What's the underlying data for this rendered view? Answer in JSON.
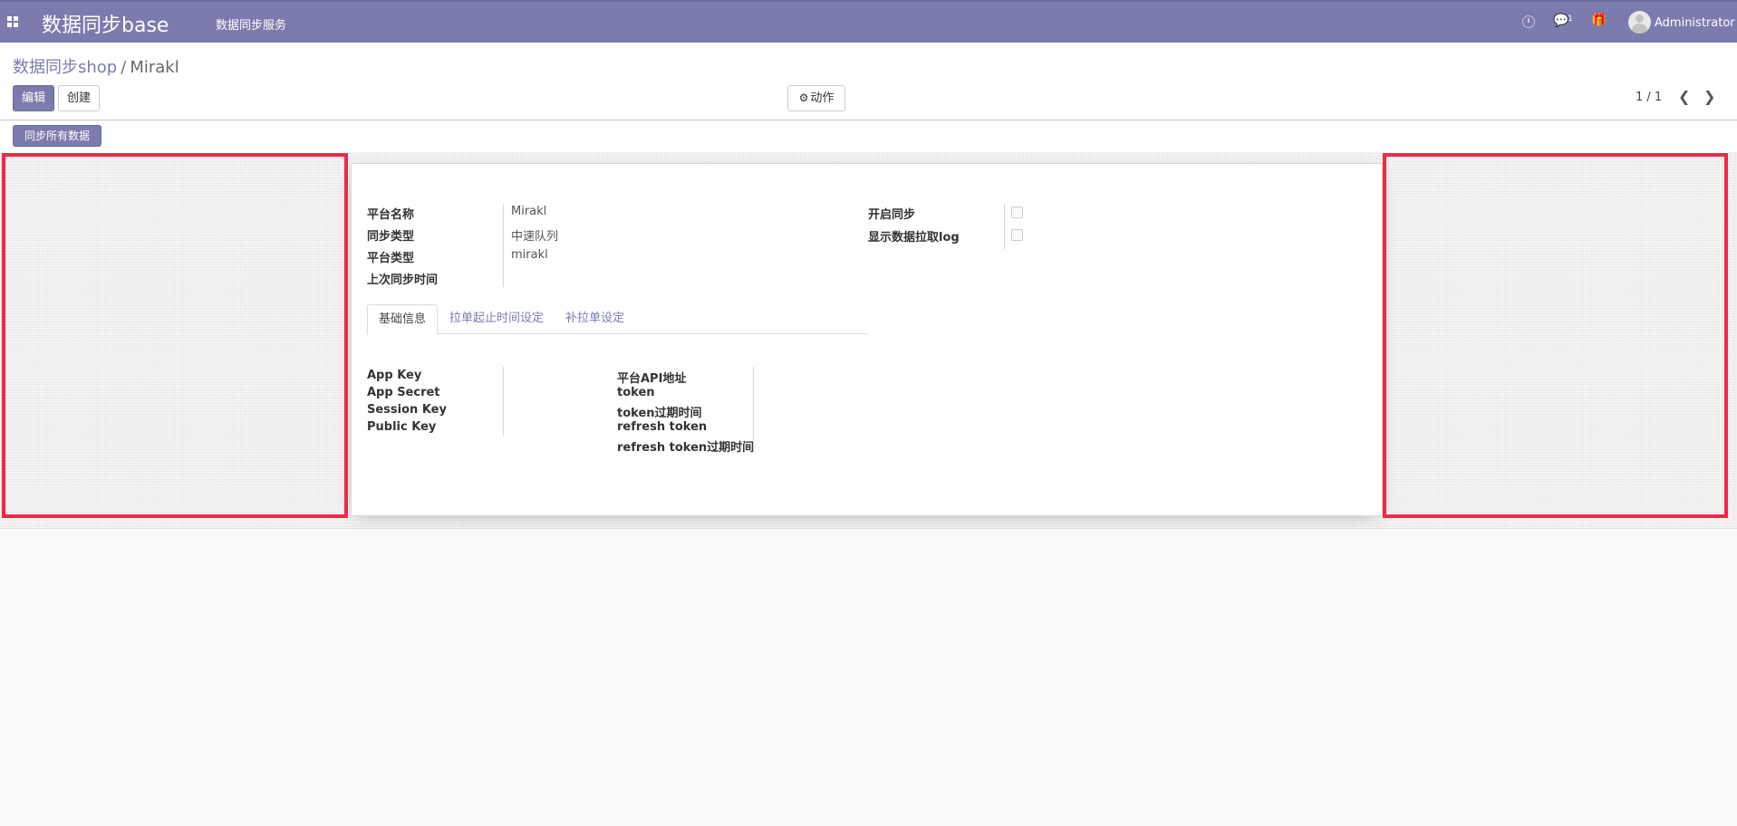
{
  "navbar": {
    "app_title": "数据同步base",
    "menu_items": [
      "数据同步服务"
    ],
    "chat_count": "1",
    "user_name": "Administrator",
    "icons": [
      "apps-grid-icon",
      "clock-icon",
      "chat-icon",
      "gift-icon",
      "avatar"
    ]
  },
  "breadcrumb": {
    "parent": "数据同步shop",
    "separator": "/",
    "current": "Mirakl"
  },
  "toolbar": {
    "edit_label": "编辑",
    "create_label": "创建",
    "action_label": "动作",
    "pager": "1 / 1",
    "prev_icon": "chevron-left-icon",
    "next_icon": "chevron-right-icon"
  },
  "statusbar": {
    "sync_all_label": "同步所有数据"
  },
  "form": {
    "left_fields": [
      {
        "label": "平台名称",
        "value": "Mirakl"
      },
      {
        "label": "同步类型",
        "value": "中速队列"
      },
      {
        "label": "平台类型",
        "value": "mirakl"
      },
      {
        "label": "上次同步时间",
        "value": ""
      }
    ],
    "right_fields": [
      {
        "label": "开启同步",
        "checked": false
      },
      {
        "label": "显示数据拉取log",
        "checked": false
      }
    ],
    "tabs": [
      {
        "label": "基础信息",
        "active": true
      },
      {
        "label": "拉单起止时间设定",
        "active": false
      },
      {
        "label": "补拉单设定",
        "active": false
      }
    ],
    "tab_left_fields": [
      "App Key",
      "App Secret",
      "Session Key",
      "Public Key"
    ],
    "tab_right_fields": [
      "平台API地址",
      "token",
      "token过期时间",
      "refresh token",
      "refresh token过期时间"
    ]
  },
  "colors": {
    "navbar": "#7c7bad",
    "primary": "#7c7bad",
    "highlight": "#f0284a"
  }
}
